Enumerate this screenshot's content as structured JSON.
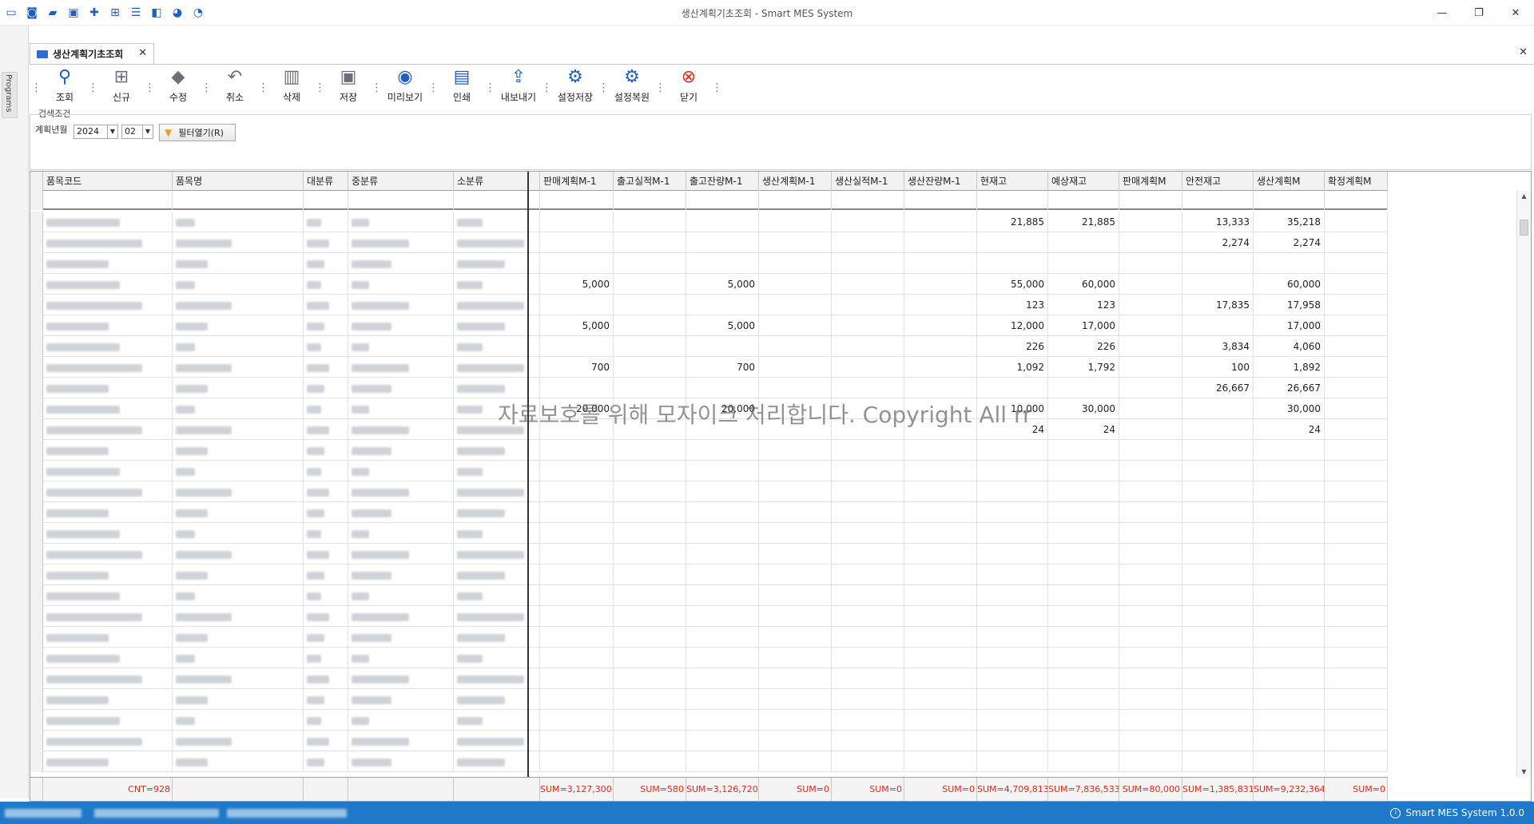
{
  "window": {
    "title": "생산계획기초조회 - Smart MES System",
    "minimize": "—",
    "restore": "❐",
    "close": "✕"
  },
  "quick_access_icons": [
    "monitor-icon",
    "camera-icon",
    "folder-icon",
    "lock-icon",
    "plus-icon",
    "tree-icon",
    "list-icon",
    "window-icon",
    "palette-icon",
    "palette-color-icon"
  ],
  "side_tab": {
    "label": "Programs"
  },
  "doc_tab": {
    "label": "생산계획기초조회",
    "close": "✕"
  },
  "toolbar": {
    "buttons": [
      {
        "label": "조회",
        "icon": "search-icon",
        "color": "#1f5fbf"
      },
      {
        "label": "신규",
        "icon": "new-icon",
        "color": "#6b7078"
      },
      {
        "label": "수정",
        "icon": "eraser-icon",
        "color": "#6b7078"
      },
      {
        "label": "취소",
        "icon": "undo-icon",
        "color": "#6b7078"
      },
      {
        "label": "삭제",
        "icon": "trash-icon",
        "color": "#6b7078"
      },
      {
        "label": "저장",
        "icon": "save-icon",
        "color": "#6b7078"
      },
      {
        "label": "미리보기",
        "icon": "eye-icon",
        "color": "#1f5fbf"
      },
      {
        "label": "인쇄",
        "icon": "print-icon",
        "color": "#1f5fbf"
      },
      {
        "label": "내보내기",
        "icon": "export-icon",
        "color": "#1f5fbf"
      },
      {
        "label": "설정저장",
        "icon": "gear-icon",
        "color": "#1f5fbf"
      },
      {
        "label": "설정복원",
        "icon": "gear-restore-icon",
        "color": "#1f5fbf"
      },
      {
        "label": "닫기",
        "icon": "close-circle-icon",
        "color": "#e0281b"
      }
    ]
  },
  "search": {
    "caption": "검색조건",
    "plan_label": "계획년월",
    "year": "2024",
    "month": "02",
    "filter_button": "필터열기(R)"
  },
  "grid": {
    "columns": [
      "품목코드",
      "품목명",
      "대분류",
      "중분류",
      "소분류",
      "판매계획M-1",
      "출고실적M-1",
      "출고잔량M-1",
      "생산계획M-1",
      "생산실적M-1",
      "생산잔량M-1",
      "현재고",
      "예상재고",
      "판매계획M",
      "안전재고",
      "생산계획M",
      "확정계획M"
    ],
    "rows": [
      [
        "",
        "",
        "",
        "",
        "",
        "",
        "",
        "",
        "",
        "",
        "",
        "21,885",
        "21,885",
        "",
        "13,333",
        "35,218",
        ""
      ],
      [
        "",
        "",
        "",
        "",
        "",
        "",
        "",
        "",
        "",
        "",
        "",
        "",
        "",
        "",
        "2,274",
        "2,274",
        ""
      ],
      [
        "",
        "",
        "",
        "",
        "",
        "",
        "",
        "",
        "",
        "",
        "",
        "",
        "",
        "",
        "",
        "",
        ""
      ],
      [
        "",
        "",
        "",
        "",
        "",
        "5,000",
        "",
        "5,000",
        "",
        "",
        "",
        "55,000",
        "60,000",
        "",
        "",
        "60,000",
        ""
      ],
      [
        "",
        "",
        "",
        "",
        "",
        "",
        "",
        "",
        "",
        "",
        "",
        "123",
        "123",
        "",
        "17,835",
        "17,958",
        ""
      ],
      [
        "",
        "",
        "",
        "",
        "",
        "5,000",
        "",
        "5,000",
        "",
        "",
        "",
        "12,000",
        "17,000",
        "",
        "",
        "17,000",
        ""
      ],
      [
        "",
        "",
        "",
        "",
        "",
        "",
        "",
        "",
        "",
        "",
        "",
        "226",
        "226",
        "",
        "3,834",
        "4,060",
        ""
      ],
      [
        "",
        "",
        "",
        "",
        "",
        "700",
        "",
        "700",
        "",
        "",
        "",
        "1,092",
        "1,792",
        "",
        "100",
        "1,892",
        ""
      ],
      [
        "",
        "",
        "",
        "",
        "",
        "",
        "",
        "",
        "",
        "",
        "",
        "",
        "",
        "",
        "26,667",
        "26,667",
        ""
      ],
      [
        "",
        "",
        "",
        "",
        "",
        "20,000",
        "",
        "20,000",
        "",
        "",
        "",
        "10,000",
        "30,000",
        "",
        "",
        "30,000",
        ""
      ],
      [
        "",
        "",
        "",
        "",
        "",
        "",
        "",
        "",
        "",
        "",
        "",
        "24",
        "24",
        "",
        "",
        "24",
        ""
      ]
    ],
    "footer": [
      "CNT=928",
      "",
      "",
      "",
      "",
      "SUM=3,127,300",
      "SUM=580",
      "SUM=3,126,720",
      "SUM=0",
      "SUM=0",
      "SUM=0",
      "SUM=4,709,813",
      "SUM=7,836,533",
      "SUM=80,000",
      "SUM=1,385,831",
      "SUM=9,232,364",
      "SUM=0"
    ]
  },
  "watermark": "자료보호를 위해 모자이크 처리합니다. Copyright All rr",
  "status": {
    "app": "Smart MES System 1.0.0"
  }
}
